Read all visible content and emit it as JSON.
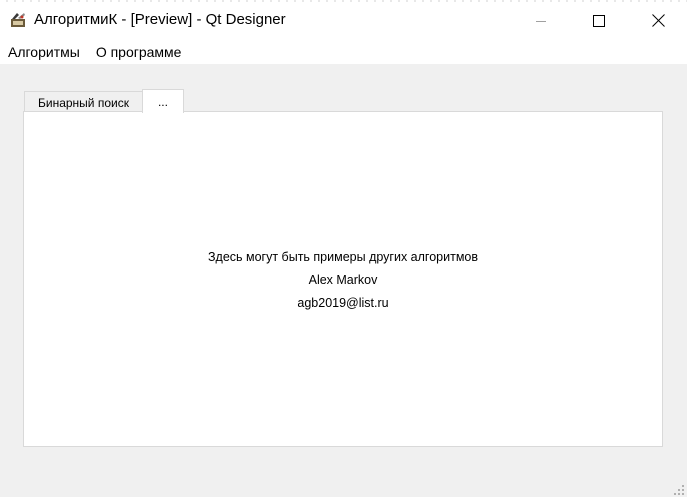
{
  "window": {
    "title": "АлгоритмиК - [Preview] - Qt Designer"
  },
  "menubar": {
    "items": [
      {
        "label": "Алгоритмы"
      },
      {
        "label": "О программе"
      }
    ]
  },
  "tabs": [
    {
      "label": "Бинарный поиск",
      "active": false
    },
    {
      "label": "...",
      "active": true
    }
  ],
  "panel": {
    "lines": [
      "Здесь могут быть примеры других алгоритмов",
      "Alex Markov",
      "agb2019@list.ru"
    ]
  },
  "icons": {
    "app": "app-icon",
    "minimize": "minimize-icon",
    "maximize": "maximize-icon",
    "close": "close-icon",
    "grip": "resize-grip-icon"
  }
}
